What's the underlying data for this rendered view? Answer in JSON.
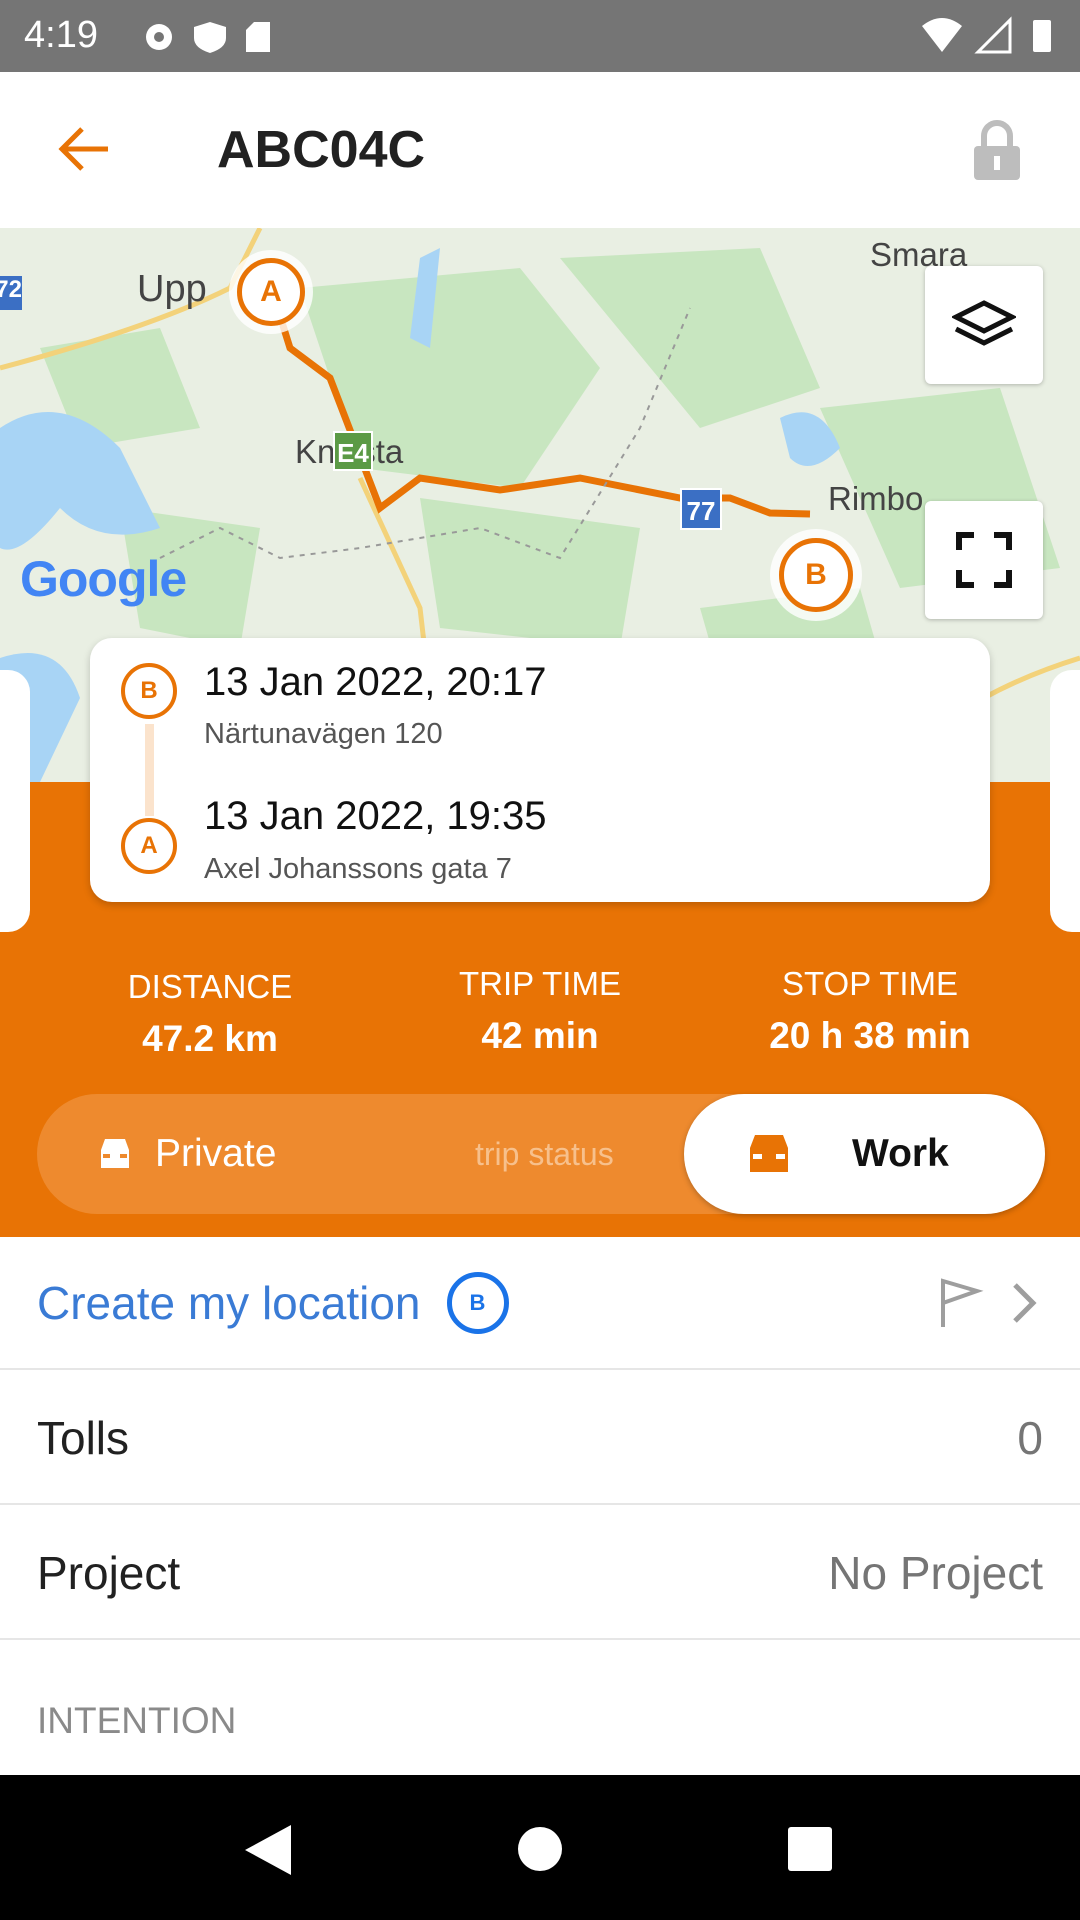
{
  "status_bar": {
    "time": "4:19",
    "icons": [
      "gear-icon",
      "shield-icon",
      "sd-card-icon",
      "wifi-icon",
      "signal-icon",
      "battery-icon"
    ]
  },
  "toolbar": {
    "title": "ABC04C",
    "back_icon": "arrow-left-icon",
    "lock_icon": "lock-icon"
  },
  "map": {
    "labels": {
      "uppsala": "Upp",
      "knivsta": "Knivsta",
      "rimbo": "Rimbo",
      "smara": "Smara",
      "e4": "E4",
      "r77": "77",
      "r72": "72"
    },
    "logo": "Google",
    "start_marker": "A",
    "end_marker": "B"
  },
  "trip": {
    "end": {
      "marker": "B",
      "datetime": "13 Jan 2022, 20:17",
      "address": "Närtunavägen 120"
    },
    "start": {
      "marker": "A",
      "datetime": "13 Jan 2022, 19:35",
      "address": "Axel Johanssons gata 7"
    }
  },
  "stats": [
    {
      "label": "DISTANCE",
      "value": "47.2 km"
    },
    {
      "label": "TRIP TIME",
      "value": "42 min"
    },
    {
      "label": "STOP TIME",
      "value": "20 h 38 min"
    }
  ],
  "trip_status": {
    "private": "Private",
    "hint": "trip status",
    "work": "Work",
    "selected": "Work"
  },
  "rows": {
    "create_location": {
      "label": "Create my location",
      "badge": "B"
    },
    "tolls": {
      "label": "Tolls",
      "value": "0"
    },
    "project": {
      "label": "Project",
      "value": "No Project"
    }
  },
  "section": {
    "intention": "INTENTION"
  },
  "colors": {
    "accent": "#e87305",
    "link": "#3a7bd5",
    "status_bar": "#757575"
  }
}
